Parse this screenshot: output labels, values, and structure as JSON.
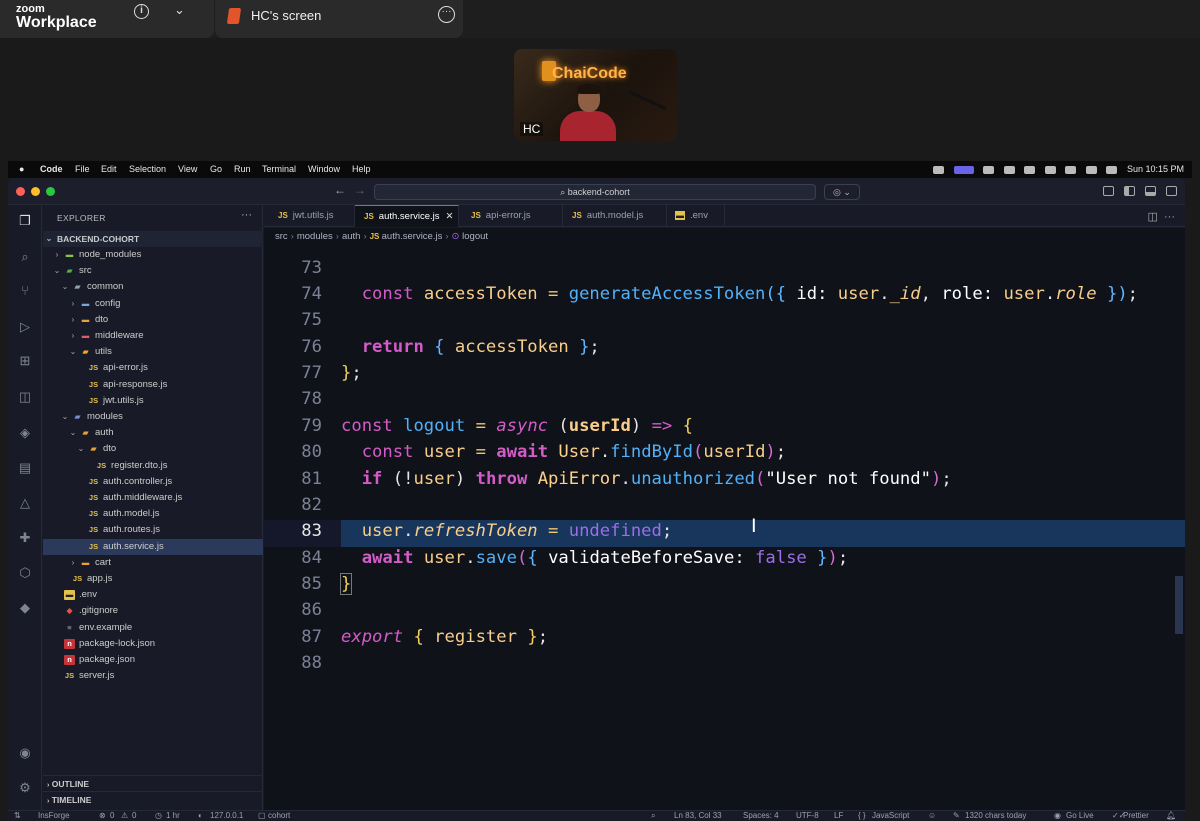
{
  "zoom": {
    "brand_small": "zoom",
    "brand_big": "Workplace",
    "tab_label": "HC's screen",
    "participant_name": "HC",
    "participant_sign": "ChaiCode"
  },
  "menubar": {
    "apple": "",
    "app": "Code",
    "items": [
      "File",
      "Edit",
      "Selection",
      "View",
      "Go",
      "Run",
      "Terminal",
      "Window",
      "Help"
    ],
    "clock": "Sun 10:15 PM"
  },
  "titlebar": {
    "search": "backend-cohort"
  },
  "explorer": {
    "title": "EXPLORER",
    "root": "BACKEND-COHORT",
    "tree": [
      {
        "label": "node_modules",
        "kind": "folder",
        "open": false,
        "depth": 1
      },
      {
        "label": "src",
        "kind": "folder",
        "open": true,
        "depth": 1
      },
      {
        "label": "common",
        "kind": "folder",
        "open": true,
        "depth": 2
      },
      {
        "label": "config",
        "kind": "folder",
        "open": false,
        "depth": 3
      },
      {
        "label": "dto",
        "kind": "folder",
        "open": false,
        "depth": 3
      },
      {
        "label": "middleware",
        "kind": "folder",
        "open": false,
        "depth": 3
      },
      {
        "label": "utils",
        "kind": "folder",
        "open": true,
        "depth": 3
      },
      {
        "label": "api-error.js",
        "kind": "js",
        "depth": 4
      },
      {
        "label": "api-response.js",
        "kind": "js",
        "depth": 4
      },
      {
        "label": "jwt.utils.js",
        "kind": "js",
        "depth": 4
      },
      {
        "label": "modules",
        "kind": "folder",
        "open": true,
        "depth": 2
      },
      {
        "label": "auth",
        "kind": "folder",
        "open": true,
        "depth": 3
      },
      {
        "label": "dto",
        "kind": "folder",
        "open": true,
        "depth": 4
      },
      {
        "label": "register.dto.js",
        "kind": "js",
        "depth": 5
      },
      {
        "label": "auth.controller.js",
        "kind": "js",
        "depth": 4
      },
      {
        "label": "auth.middleware.js",
        "kind": "js",
        "depth": 4
      },
      {
        "label": "auth.model.js",
        "kind": "js",
        "depth": 4
      },
      {
        "label": "auth.routes.js",
        "kind": "js",
        "depth": 4
      },
      {
        "label": "auth.service.js",
        "kind": "js",
        "depth": 4,
        "selected": true
      },
      {
        "label": "cart",
        "kind": "folder",
        "open": false,
        "depth": 3
      },
      {
        "label": "app.js",
        "kind": "js",
        "depth": 2
      },
      {
        "label": ".env",
        "kind": "env",
        "depth": 1
      },
      {
        "label": ".gitignore",
        "kind": "git",
        "depth": 1
      },
      {
        "label": "env.example",
        "kind": "file",
        "depth": 1
      },
      {
        "label": "package-lock.json",
        "kind": "npm",
        "depth": 1
      },
      {
        "label": "package.json",
        "kind": "npm",
        "depth": 1
      },
      {
        "label": "server.js",
        "kind": "js",
        "depth": 1
      }
    ],
    "outline": "OUTLINE",
    "timeline": "TIMELINE"
  },
  "tabs": [
    {
      "label": "jwt.utils.js",
      "active": false
    },
    {
      "label": "auth.service.js",
      "active": true
    },
    {
      "label": "api-error.js",
      "active": false
    },
    {
      "label": "auth.model.js",
      "active": false
    },
    {
      "label": ".env",
      "active": false
    }
  ],
  "breadcrumb": [
    "src",
    "modules",
    "auth",
    "auth.service.js",
    "logout"
  ],
  "editor": {
    "current_line": 83,
    "lines": [
      73,
      74,
      75,
      76,
      77,
      78,
      79,
      80,
      81,
      82,
      83,
      84,
      85,
      86,
      87,
      88
    ]
  },
  "status": {
    "branch": "InsForge",
    "errors": "0",
    "warnings": "0",
    "time": "1 hr",
    "host": "127.0.0.1",
    "project": "cohort",
    "position": "Ln 83, Col 33",
    "spaces": "Spaces: 4",
    "encoding": "UTF-8",
    "eol": "LF",
    "language": "JavaScript",
    "chars": "1320 chars today",
    "golive": "Go Live",
    "prettier": "Prettier"
  }
}
